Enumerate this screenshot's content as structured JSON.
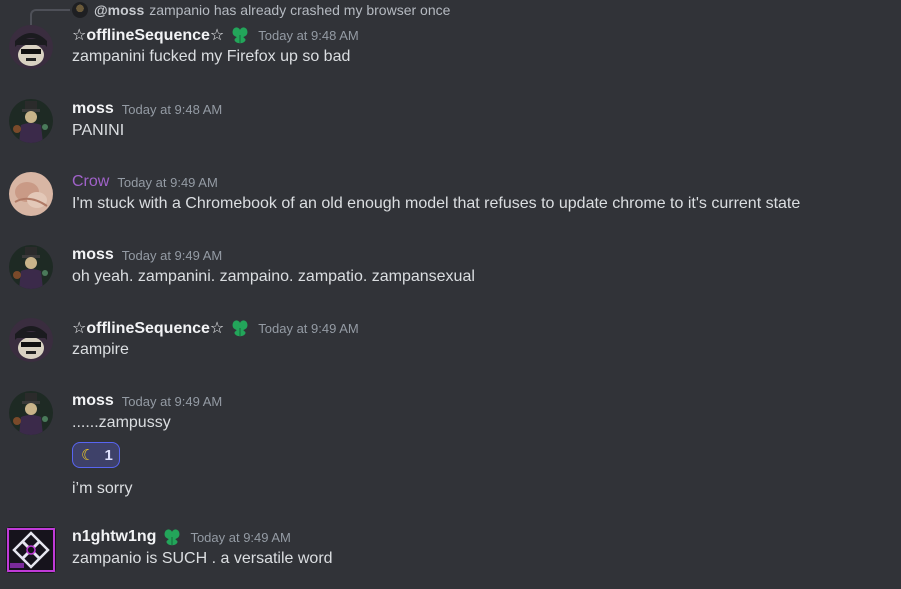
{
  "colors": {
    "background": "#313338",
    "text": "#dbdee1",
    "timestamp": "#949ba4",
    "crow_name": "#a062c9",
    "role_icon": "#23a55a",
    "reaction_bg": "#3e4169",
    "reaction_border": "#5865f2"
  },
  "reply": {
    "mention": "@moss",
    "text": "zampanio has already crashed my browser once"
  },
  "messages": [
    {
      "author": "☆offlineSequence☆",
      "role_icon": "leaf-role-icon",
      "timestamp": "Today at 9:48 AM",
      "content": "zampanini fucked my Firefox up so bad"
    },
    {
      "author": "moss",
      "timestamp": "Today at 9:48 AM",
      "content": "PANINI"
    },
    {
      "author": "Crow",
      "timestamp": "Today at 9:49 AM",
      "content": "I'm stuck with a Chromebook of an old enough model that refuses to update chrome to it's current state"
    },
    {
      "author": "moss",
      "timestamp": "Today at 9:49 AM",
      "content": "oh yeah. zampanini. zampaino. zampatio. zampansexual"
    },
    {
      "author": "☆offlineSequence☆",
      "role_icon": "leaf-role-icon",
      "timestamp": "Today at 9:49 AM",
      "content": "zampire"
    },
    {
      "author": "moss",
      "timestamp": "Today at 9:49 AM",
      "content": "......zampussy",
      "reaction": {
        "emoji": "☾",
        "icon": "crescent-moon-icon",
        "count": "1"
      },
      "followup": "i’m sorry"
    },
    {
      "author": "n1ghtw1ng",
      "role_icon": "leaf-role-icon",
      "timestamp": "Today at 9:49 AM",
      "content": "zampanio is SUCH  . a versatile word"
    }
  ]
}
